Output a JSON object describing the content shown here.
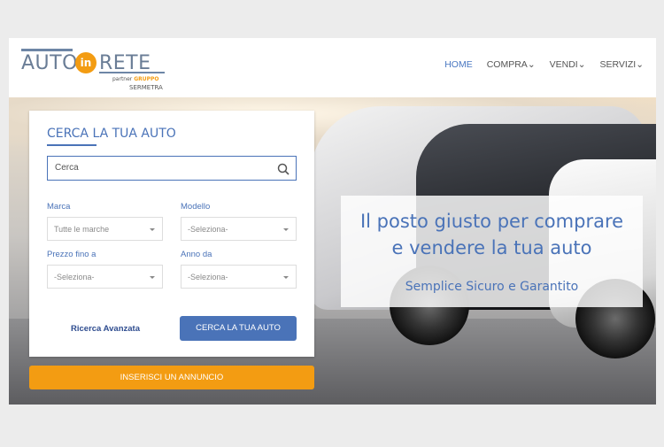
{
  "logo": {
    "word1": "AUTO",
    "in": "in",
    "word2": "RETE",
    "sub_partner": "partner",
    "sub_group": "GRUPPO",
    "sub_company": "SERMETRA"
  },
  "nav": {
    "items": [
      "HOME",
      "COMPRA",
      "VENDI",
      "SERVIZI"
    ],
    "active": "HOME"
  },
  "search": {
    "title": "CERCA LA TUA AUTO",
    "placeholder": "Cerca",
    "marca_label": "Marca",
    "marca_value": "Tutte le marche",
    "modello_label": "Modello",
    "modello_value": "-Seleziona-",
    "prezzo_label": "Prezzo fino a",
    "prezzo_value": "-Seleziona-",
    "anno_label": "Anno da",
    "anno_value": "-Seleziona-",
    "advanced": "Ricerca Avanzata",
    "button": "CERCA LA TUA AUTO"
  },
  "insert_button": "INSERISCI UN ANNUNCIO",
  "promo": {
    "line1": "Il posto giusto per comprare",
    "line2": "e vendere la tua auto",
    "line3": "Semplice Sicuro e Garantito"
  },
  "colors": {
    "brand_blue": "#4a73b8",
    "accent_orange": "#f39c12"
  }
}
